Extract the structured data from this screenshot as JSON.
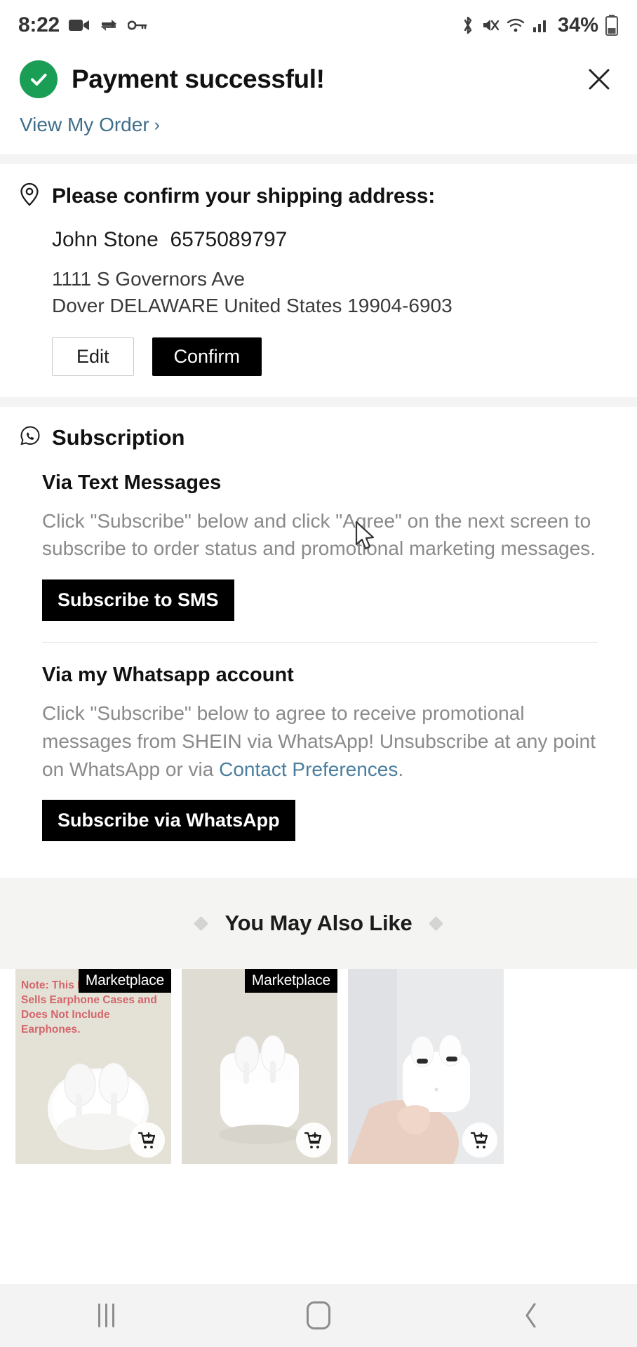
{
  "status_bar": {
    "time": "8:22",
    "battery_percent": "34%",
    "left_icons": [
      "video-camera-icon",
      "sync-icon",
      "key-icon"
    ],
    "right_icons": [
      "bluetooth-icon",
      "mute-icon",
      "wifi-icon",
      "cellular-signal-icon",
      "battery-icon"
    ]
  },
  "success": {
    "title": "Payment successful!",
    "icon": "check-circle-icon",
    "accent_color": "#1a9d54",
    "close_label": "✕",
    "view_order_label": "View My Order",
    "view_order_chevron": "›",
    "link_color": "#3f6e8c"
  },
  "address": {
    "icon": "location-pin-icon",
    "heading": "Please confirm your shipping address:",
    "name": "John Stone",
    "phone": "6575089797",
    "line1": "1111 S Governors Ave",
    "line2": "Dover DELAWARE United States 19904-6903",
    "edit_label": "Edit",
    "confirm_label": "Confirm"
  },
  "subscription": {
    "icon": "whatsapp-icon",
    "heading": "Subscription",
    "sms": {
      "subheading": "Via Text Messages",
      "body": "Click \"Subscribe\" below and click \"Agree\" on the next screen to subscribe to order status and promotional marketing messages.",
      "button_label": "Subscribe to SMS"
    },
    "whatsapp": {
      "subheading": "Via my Whatsapp account",
      "body_part1": "Click \"Subscribe\" below to agree to receive promotional messages from SHEIN via WhatsApp! Unsubscribe at any point on WhatsApp or via ",
      "link_text": "Contact Preferences",
      "body_part2": ".",
      "button_label": "Subscribe via WhatsApp"
    }
  },
  "recommendations": {
    "title": "You May Also Like",
    "ornament": "diamond-icon",
    "items": [
      {
        "badge": "Marketplace",
        "note": "Note: This Product Only Sells Earphone Cases and Does Not Include Earphones.",
        "image_alt": "white-airpods-case-product-image",
        "cart_icon": "add-to-cart-icon"
      },
      {
        "badge": "Marketplace",
        "note": "",
        "image_alt": "white-airpods-case-open-product-image",
        "cart_icon": "add-to-cart-icon"
      },
      {
        "badge": "",
        "note": "",
        "image_alt": "hand-holding-airpods-pro-product-image",
        "cart_icon": "add-to-cart-icon"
      }
    ]
  },
  "nav_bar": {
    "recents_label": "recents-icon",
    "home_label": "home-icon",
    "back_label": "back-icon"
  }
}
